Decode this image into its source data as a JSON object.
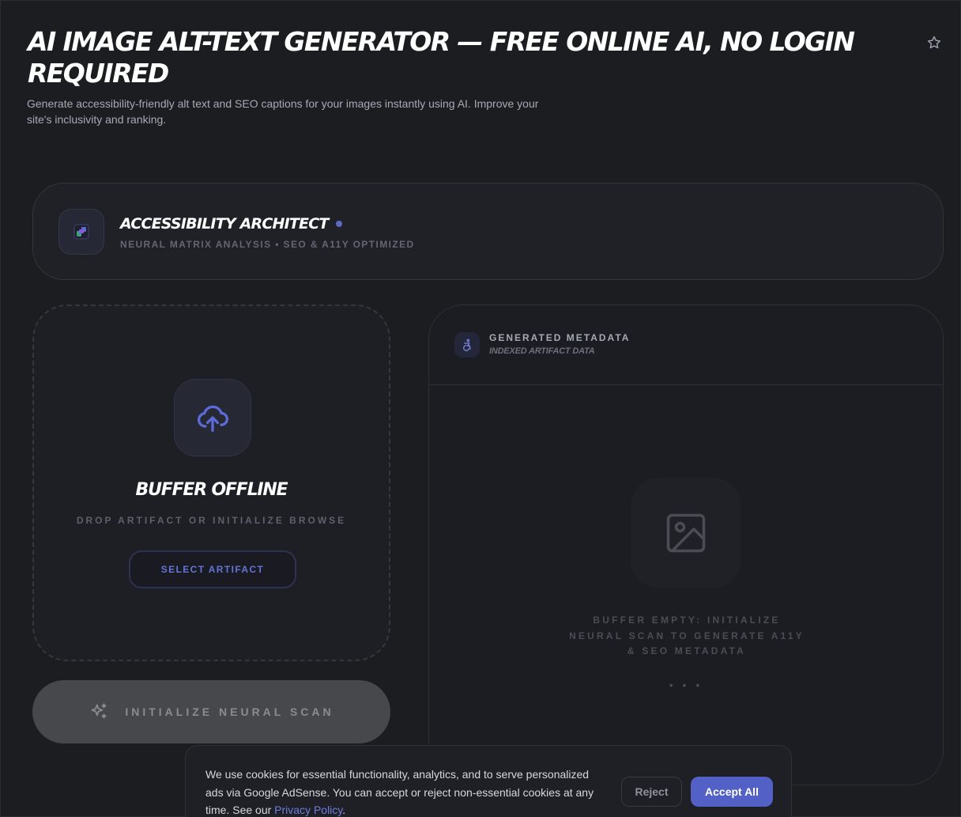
{
  "page": {
    "title": "AI IMAGE ALT-TEXT GENERATOR — FREE ONLINE AI, NO LOGIN REQUIRED",
    "subtitle": "Generate accessibility-friendly alt text and SEO captions for your images instantly using AI. Improve your site's inclusivity and ranking.",
    "favorite_icon": "star-icon"
  },
  "header_card": {
    "title": "ACCESSIBILITY ARCHITECT",
    "subtitle": "NEURAL MATRIX ANALYSIS • SEO & A11Y OPTIMIZED",
    "logo_icon": "puzzle-icon"
  },
  "upload": {
    "icon": "cloud-upload-icon",
    "title": "BUFFER OFFLINE",
    "subtitle": "DROP ARTIFACT OR INITIALIZE BROWSE",
    "button_label": "SELECT ARTIFACT"
  },
  "scan_button": {
    "icon": "sparkles-icon",
    "label": "INITIALIZE NEURAL SCAN"
  },
  "metadata_panel": {
    "icon": "accessibility-icon",
    "title": "GENERATED METADATA",
    "subtitle": "INDEXED ARTIFACT DATA",
    "empty_icon": "image-icon",
    "empty_text": "BUFFER EMPTY: INITIALIZE NEURAL SCAN TO GENERATE A11Y & SEO METADATA",
    "empty_dots": "• • •"
  },
  "cookie_banner": {
    "text": "We use cookies for essential functionality, analytics, and to serve personalized ads via Google AdSense. You can accept or reject non-essential cookies at any time. See our",
    "link_text": "Privacy Policy",
    "link_suffix": ".",
    "reject_label": "Reject",
    "accept_label": "Accept All"
  },
  "colors": {
    "accent": "#5361c6",
    "background": "#1c1d21",
    "card": "#202126"
  }
}
